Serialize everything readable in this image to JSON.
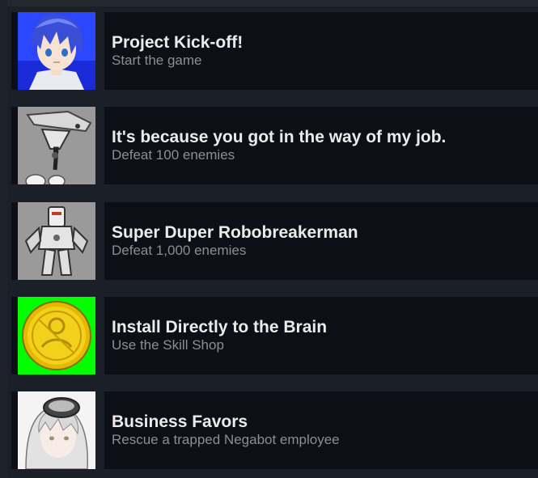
{
  "achievements": [
    {
      "title": "Project Kick-off!",
      "description": "Start the game",
      "icon": "blue-haired-character-icon"
    },
    {
      "title": "It's because you got in the way of my job.",
      "description": "Defeat 100 enemies",
      "icon": "robot-arm-icon"
    },
    {
      "title": "Super Duper Robobreakerman",
      "description": "Defeat 1,000 enemies",
      "icon": "robot-mech-icon"
    },
    {
      "title": "Install Directly to the Brain",
      "description": "Use the Skill Shop",
      "icon": "gold-coin-icon"
    },
    {
      "title": "Business Favors",
      "description": "Rescue a trapped Negabot employee",
      "icon": "white-haired-character-icon"
    }
  ],
  "colors": {
    "background": "#1b2028",
    "row": "#0c0f15",
    "title": "#ebebeb",
    "description": "#8b8f95",
    "coin_bg": "#00ff00",
    "coin": "#f2d11c"
  }
}
